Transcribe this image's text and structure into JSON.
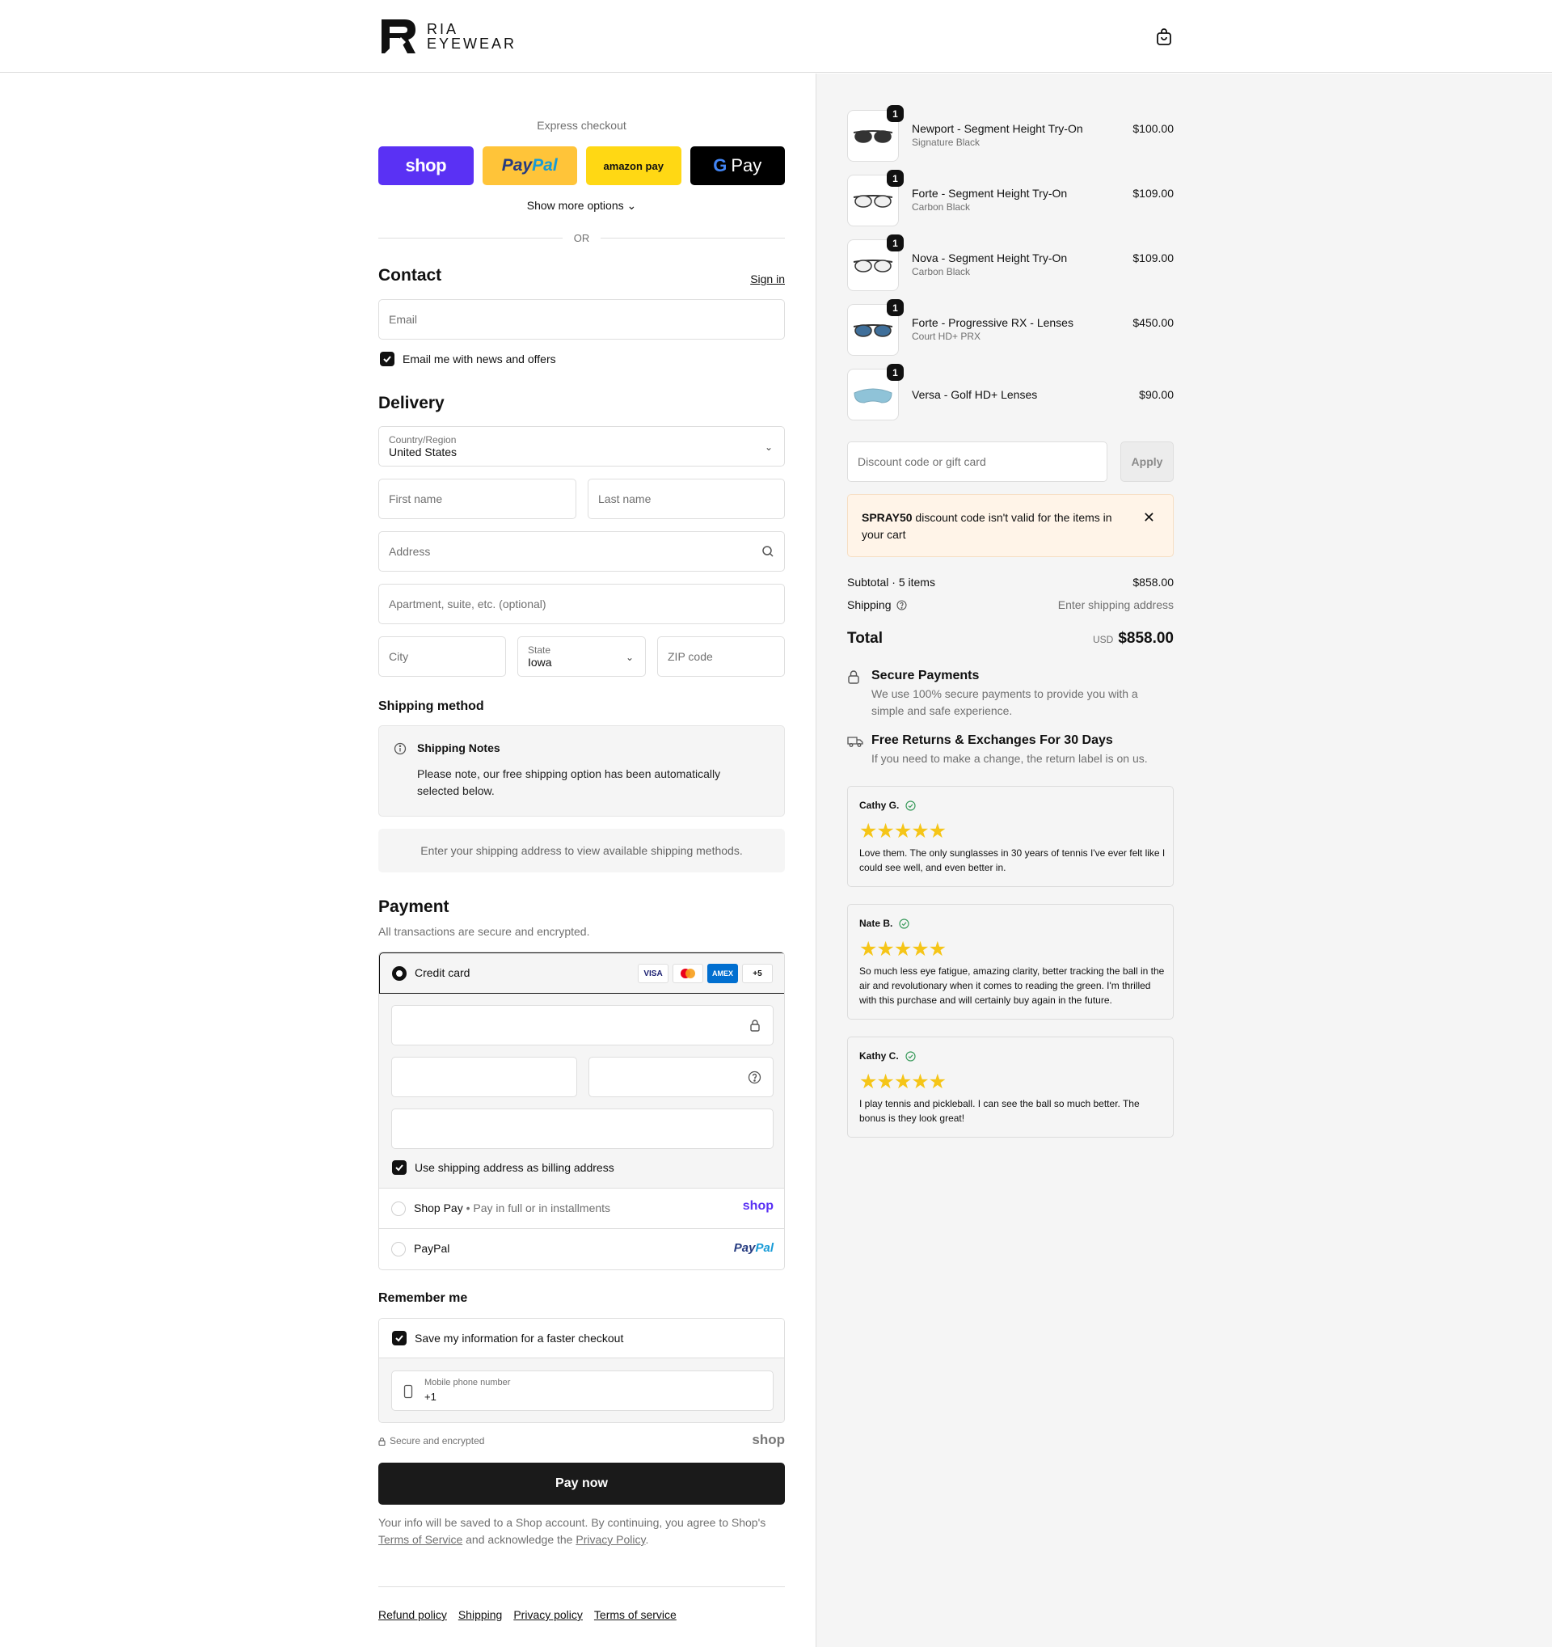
{
  "brand": {
    "name_line1": "RIA",
    "name_line2": "EYEWEAR"
  },
  "express": {
    "title": "Express checkout",
    "shop_pay": "shop",
    "paypal_1": "Pay",
    "paypal_2": "Pal",
    "amazon_pay": "amazon pay",
    "google_pay": "Pay",
    "show_more": "Show more options",
    "or": "OR"
  },
  "contact": {
    "title": "Contact",
    "sign_in": "Sign in",
    "email_placeholder": "Email",
    "news_checkbox": "Email me with news and offers",
    "news_checked": true
  },
  "delivery": {
    "title": "Delivery",
    "country_label": "Country/Region",
    "country_value": "United States",
    "first_name": "First name",
    "last_name": "Last name",
    "address": "Address",
    "apartment": "Apartment, suite, etc. (optional)",
    "city": "City",
    "state_label": "State",
    "state_value": "Iowa",
    "zip": "ZIP code"
  },
  "shipping": {
    "title": "Shipping method",
    "notes_title": "Shipping Notes",
    "notes_text": "Please note, our free shipping option has been automatically selected below.",
    "empty_text": "Enter your shipping address to view available shipping methods."
  },
  "payment": {
    "title": "Payment",
    "subtitle": "All transactions are secure and encrypted.",
    "credit_card": "Credit card",
    "brands": [
      "VISA",
      "",
      "AMEX",
      "+5"
    ],
    "billing_checkbox": "Use shipping address as billing address",
    "shop_pay_label": "Shop Pay",
    "shop_pay_sub": "Pay in full or in installments",
    "shop_pay_logo": "shop",
    "paypal_label": "PayPal",
    "paypal_logo_1": "Pay",
    "paypal_logo_2": "Pal"
  },
  "remember": {
    "title": "Remember me",
    "save_checkbox": "Save my information for a faster checkout",
    "phone_label": "Mobile phone number",
    "phone_value": "+1"
  },
  "checkout": {
    "secure_text": "Secure and encrypted",
    "shop_logo": "shop",
    "pay_now": "Pay now",
    "legal_1": "Your info will be saved to a Shop account. By continuing, you agree to Shop's",
    "legal_tos": "Terms of Service",
    "legal_2": "and acknowledge the",
    "legal_privacy": "Privacy Policy",
    "legal_3": "."
  },
  "footer": {
    "links": [
      "Refund policy",
      "Shipping",
      "Privacy policy",
      "Terms of service"
    ]
  },
  "cart": {
    "items": [
      {
        "qty": "1",
        "name": "Newport - Segment Height Try-On",
        "variant": "Signature Black",
        "price": "$100.00",
        "lens": "#333333"
      },
      {
        "qty": "1",
        "name": "Forte - Segment Height Try-On",
        "variant": "Carbon Black",
        "price": "$109.00",
        "lens": "#f0f0f0"
      },
      {
        "qty": "1",
        "name": "Nova - Segment Height Try-On",
        "variant": "Carbon Black",
        "price": "$109.00",
        "lens": "#f0f0f0"
      },
      {
        "qty": "1",
        "name": "Forte - Progressive RX - Lenses",
        "variant": "Court HD+ PRX",
        "price": "$450.00",
        "lens": "#3f6f9a"
      },
      {
        "qty": "1",
        "name": "Versa - Golf HD+ Lenses",
        "variant": "",
        "price": "$90.00",
        "lens": "#8fc3d8"
      }
    ],
    "discount_placeholder": "Discount code or gift card",
    "apply": "Apply",
    "warning_code": "SPRAY50",
    "warning_text": "discount code isn't valid for the items in your cart",
    "subtotal_label": "Subtotal · 5 items",
    "subtotal_value": "$858.00",
    "shipping_label": "Shipping",
    "shipping_value": "Enter shipping address",
    "total_label": "Total",
    "currency": "USD",
    "total_value": "$858.00"
  },
  "features": [
    {
      "title": "Secure Payments",
      "text": "We use 100% secure payments to provide you with a simple and safe experience."
    },
    {
      "title": "Free Returns & Exchanges For 30 Days",
      "text": "If you need to make a change, the return label is on us."
    }
  ],
  "reviews": [
    {
      "name": "Cathy G.",
      "stars": "★★★★★",
      "text": "Love them. The only sunglasses in 30 years of tennis I've ever felt like I could see well, and even better in."
    },
    {
      "name": "Nate B.",
      "stars": "★★★★★",
      "text": "So much less eye fatigue, amazing clarity, better tracking the ball in the air and revolutionary when it comes to reading the green. I'm thrilled with this purchase and will certainly buy again in the future."
    },
    {
      "name": "Kathy C.",
      "stars": "★★★★★",
      "text": "I play tennis and pickleball. I can see the ball so much better. The bonus is they look great!"
    }
  ],
  "colors": {
    "accent": "#111111",
    "shop_purple": "#5a31f4",
    "star": "#f5c518",
    "warning_bg": "#fff4e8"
  }
}
